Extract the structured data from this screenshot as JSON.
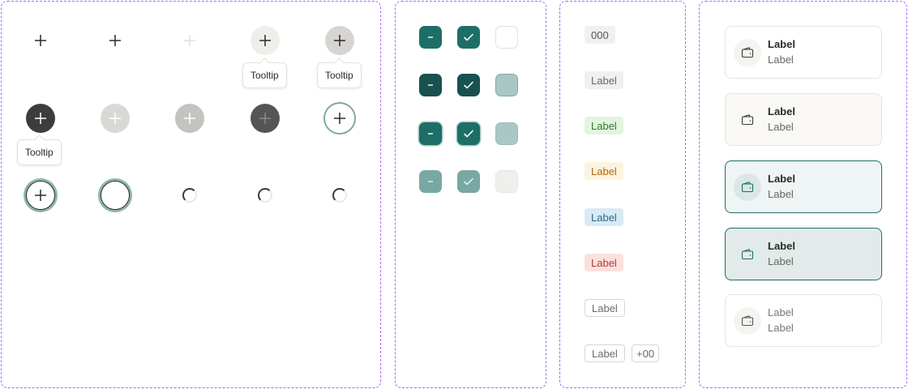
{
  "tooltips": {
    "t1": "Tooltip",
    "t2": "Tooltip",
    "t3": "Tooltip"
  },
  "icon_buttons": {
    "icon": "plus-icon",
    "loading_icon": "spinner-icon"
  },
  "checkboxes": {
    "indeterminate_icon": "minus-icon",
    "checked_icon": "check-icon"
  },
  "tags": [
    {
      "label": "000",
      "variant": "count"
    },
    {
      "label": "Label",
      "variant": "neutral"
    },
    {
      "label": "Label",
      "variant": "success"
    },
    {
      "label": "Label",
      "variant": "warning"
    },
    {
      "label": "Label",
      "variant": "info"
    },
    {
      "label": "Label",
      "variant": "danger"
    },
    {
      "label": "Label",
      "variant": "outline"
    },
    {
      "label": "Label",
      "variant": "outline"
    },
    {
      "label": "+00",
      "variant": "outline-count"
    }
  ],
  "cards": [
    {
      "title": "Label",
      "subtitle": "Label",
      "state": "default",
      "icon": "wallet-icon"
    },
    {
      "title": "Label",
      "subtitle": "Label",
      "state": "hover",
      "icon": "wallet-icon"
    },
    {
      "title": "Label",
      "subtitle": "Label",
      "state": "selected",
      "icon": "wallet-icon"
    },
    {
      "title": "Label",
      "subtitle": "Label",
      "state": "selected-pressed",
      "icon": "wallet-icon"
    },
    {
      "title": "Label",
      "subtitle": "Label",
      "state": "disabled",
      "icon": "wallet-icon"
    }
  ],
  "colors": {
    "frame_border": "#a66bf0",
    "primary": "#1e6e68",
    "primary_dark": "#17524e",
    "primary_muted": "#79a8a4",
    "primary_light": "#aac7c4",
    "neutral_tag_bg": "#f0f0ee",
    "success_bg": "#e3f4e0",
    "warning_bg": "#fdf3df",
    "info_bg": "#d8eaf4",
    "danger_bg": "#fbe1dc"
  }
}
